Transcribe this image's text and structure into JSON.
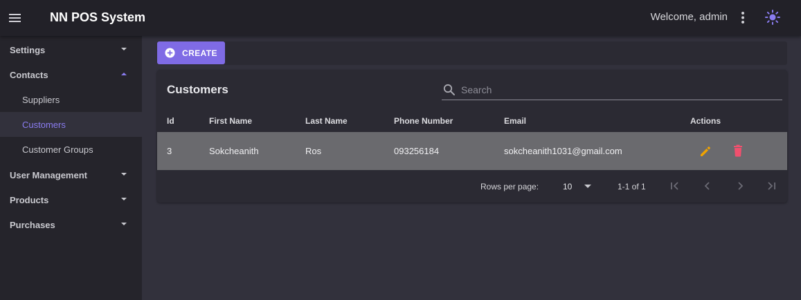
{
  "app": {
    "title": "NN POS System",
    "welcome": "Welcome, admin"
  },
  "sidebar": {
    "items": [
      {
        "label": "Settings"
      },
      {
        "label": "Contacts"
      },
      {
        "label": "Suppliers"
      },
      {
        "label": "Customers"
      },
      {
        "label": "Customer Groups"
      },
      {
        "label": "User Management"
      },
      {
        "label": "Products"
      },
      {
        "label": "Purchases"
      }
    ],
    "active": "Customers"
  },
  "toolbar": {
    "create_label": "CREATE"
  },
  "table": {
    "title": "Customers",
    "search_placeholder": "Search",
    "columns": [
      "Id",
      "First Name",
      "Last Name",
      "Phone Number",
      "Email",
      "Actions"
    ],
    "rows": [
      {
        "id": "3",
        "first_name": "Sokcheanith",
        "last_name": "Ros",
        "phone": "093256184",
        "email": "sokcheanith1031@gmail.com"
      }
    ]
  },
  "pagination": {
    "rows_per_page_label": "Rows per page:",
    "rows_per_page": "10",
    "range": "1-1 of 1"
  },
  "colors": {
    "accent": "#7f6be5",
    "edit": "#f0a300",
    "delete": "#f0506e"
  },
  "icons": [
    "menu-icon",
    "more-vert-icon",
    "theme-toggle-icon",
    "add-circle-icon",
    "search-icon",
    "edit-icon",
    "delete-icon",
    "first-page-icon",
    "prev-page-icon",
    "next-page-icon",
    "last-page-icon"
  ]
}
